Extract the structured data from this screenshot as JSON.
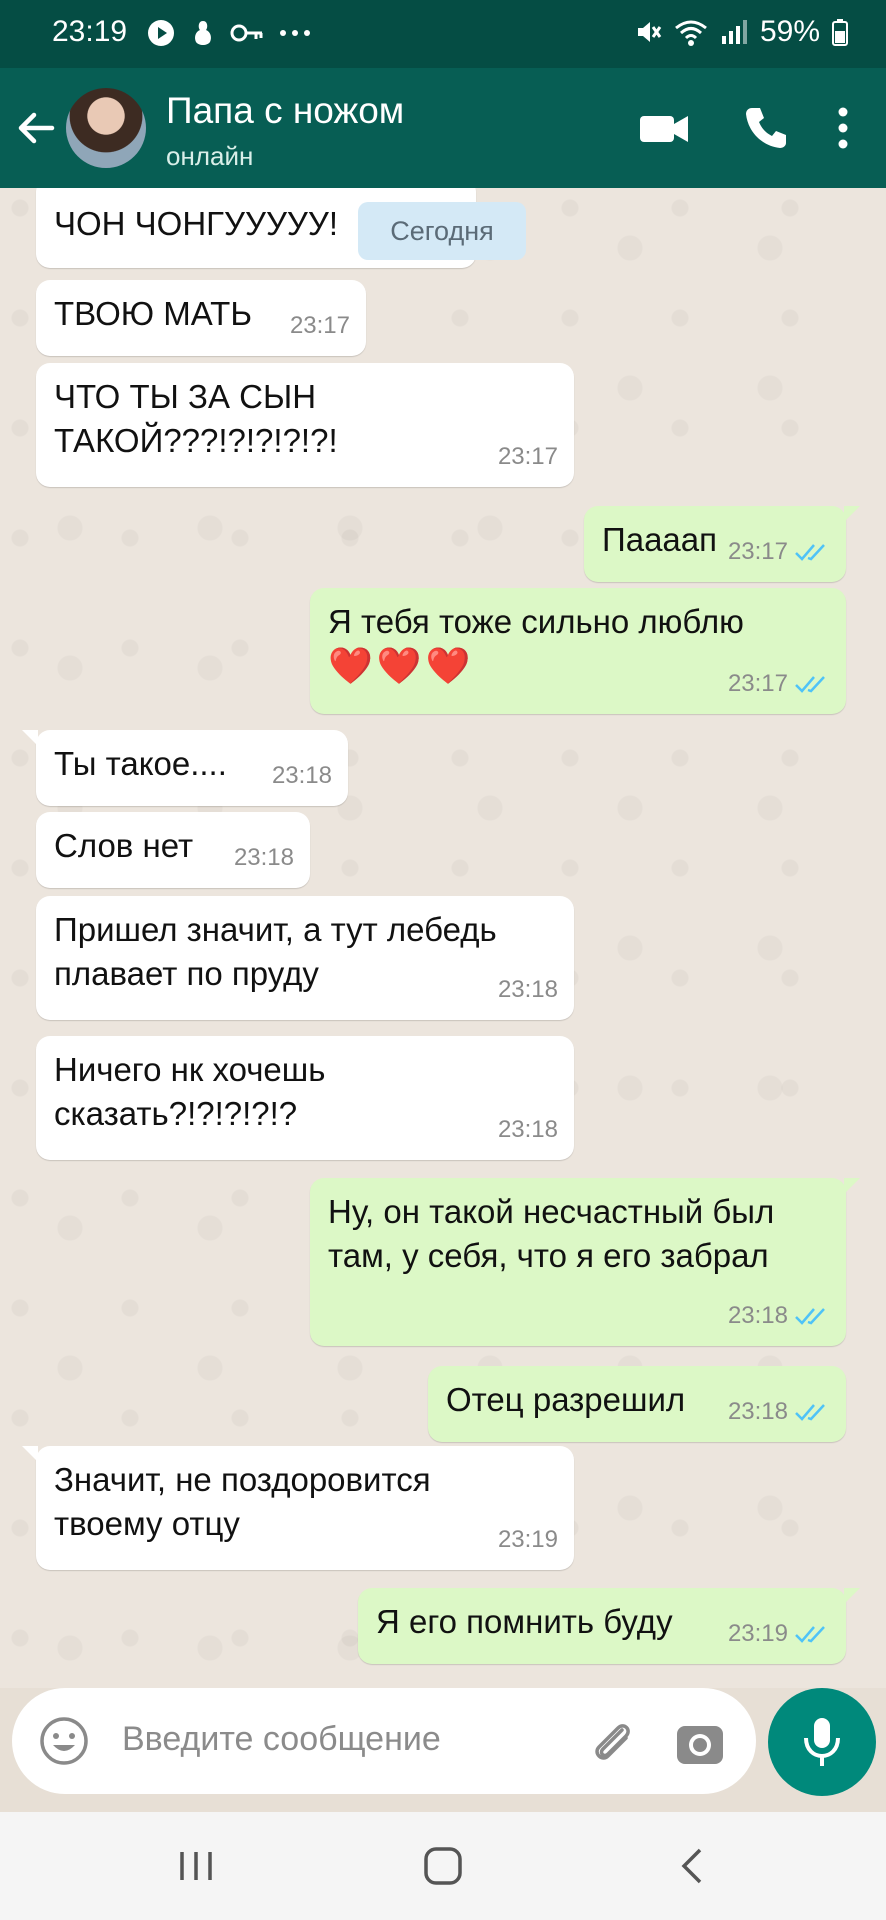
{
  "status_bar": {
    "time": "23:19",
    "battery": "59%"
  },
  "header": {
    "contact_name": "Папа с ножом",
    "contact_status": "онлайн"
  },
  "date_chip": "Сегодня",
  "messages": [
    {
      "dir": "in",
      "text": "ЧОН ЧОНГУУУУУ!",
      "time": ""
    },
    {
      "dir": "in",
      "text": "ТВОЮ МАТЬ",
      "time": "23:17"
    },
    {
      "dir": "in",
      "text": "ЧТО ТЫ ЗА СЫН ТАКОЙ???!?!?!?!?!",
      "time": "23:17"
    },
    {
      "dir": "out",
      "text": "Паааап",
      "time": "23:17"
    },
    {
      "dir": "out",
      "text": "Я тебя тоже сильно люблю",
      "extra": "❤️❤️❤️",
      "time": "23:17"
    },
    {
      "dir": "in",
      "text": "Ты такое....",
      "time": "23:18"
    },
    {
      "dir": "in",
      "text": "Слов нет",
      "time": "23:18"
    },
    {
      "dir": "in",
      "text": "Пришел значит, а тут лебедь плавает по пруду",
      "time": "23:18"
    },
    {
      "dir": "in",
      "text": "Ничего нк хочешь сказать?!?!?!?!?",
      "time": "23:18"
    },
    {
      "dir": "out",
      "text": "Ну, он такой несчастный был там, у себя, что я его забрал",
      "time": "23:18"
    },
    {
      "dir": "out",
      "text": "Отец разрешил",
      "time": "23:18"
    },
    {
      "dir": "in",
      "text": "Значит, не поздоровится твоему отцу",
      "time": "23:19"
    },
    {
      "dir": "out",
      "text": "Я его помнить буду",
      "time": "23:19"
    }
  ],
  "input": {
    "placeholder": "Введите сообщение"
  },
  "icons": {
    "back": "arrow-left-icon",
    "video": "video-call-icon",
    "call": "phone-icon",
    "menu": "more-vert-icon",
    "emoji": "emoji-icon",
    "attach": "paperclip-icon",
    "camera": "camera-icon",
    "mic": "microphone-icon"
  },
  "colors": {
    "header": "#075e54",
    "status_bar": "#054d44",
    "incoming": "#ffffff",
    "outgoing": "#dcf8c6",
    "tick": "#4fc3f7",
    "fab": "#00897b"
  }
}
